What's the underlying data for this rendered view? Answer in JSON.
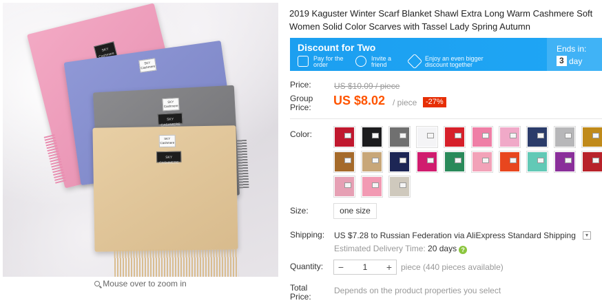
{
  "product": {
    "title": "2019 Kaguster Winter Scarf Blanket Shawl Extra Long Warm Cashmere Soft Women Solid Color Scarves with Tassel Lady Spring Autumn",
    "image_labels": {
      "label_text": "SKY Cashmere",
      "brand_text": "SKY CASHMERE"
    },
    "zoom_hint": "Mouse over to zoom in"
  },
  "promo": {
    "title": "Discount for Two",
    "items": [
      {
        "icon": "ticket-icon",
        "text": "Pay for the order"
      },
      {
        "icon": "friend-icon",
        "text": "Invite a friend"
      },
      {
        "icon": "discount-tag-icon",
        "text": "Enjoy an even bigger discount together"
      }
    ],
    "ends_label": "Ends in:",
    "days_value": "3",
    "days_unit": "day"
  },
  "price": {
    "label": "Price:",
    "old": "US $10.09 / piece",
    "group_label": "Group Price:",
    "new": "US $8.02",
    "unit": "/ piece",
    "discount": "-27%"
  },
  "color": {
    "label": "Color:",
    "swatches": [
      "#c0182e",
      "#1c1c1e",
      "#707070",
      "#f4f4f6",
      "#d6202a",
      "#ef7fa6",
      "#f0a9c8",
      "#2b3c6a",
      "#b7b7b9",
      "#c08a1a",
      "#a56a2a",
      "#c8a779",
      "#1d2655",
      "#d01c6e",
      "#2a8a5a",
      "#f2a2b8",
      "#e8461e",
      "#62c9b6",
      "#8a2f9a",
      "#b8222a",
      "#e6a0b4",
      "#f29ab3",
      "#cfc9bd"
    ]
  },
  "size": {
    "label": "Size:",
    "value": "one size"
  },
  "shipping": {
    "label": "Shipping:",
    "text": "US $7.28 to Russian Federation via AliExpress Standard Shipping",
    "est_label": "Estimated Delivery Time:",
    "est_value": "20 days"
  },
  "quantity": {
    "label": "Quantity:",
    "value": "1",
    "minus": "−",
    "plus": "+",
    "available": "piece (440 pieces available)"
  },
  "total": {
    "label": "Total Price:",
    "text": "Depends on the product properties you select"
  }
}
